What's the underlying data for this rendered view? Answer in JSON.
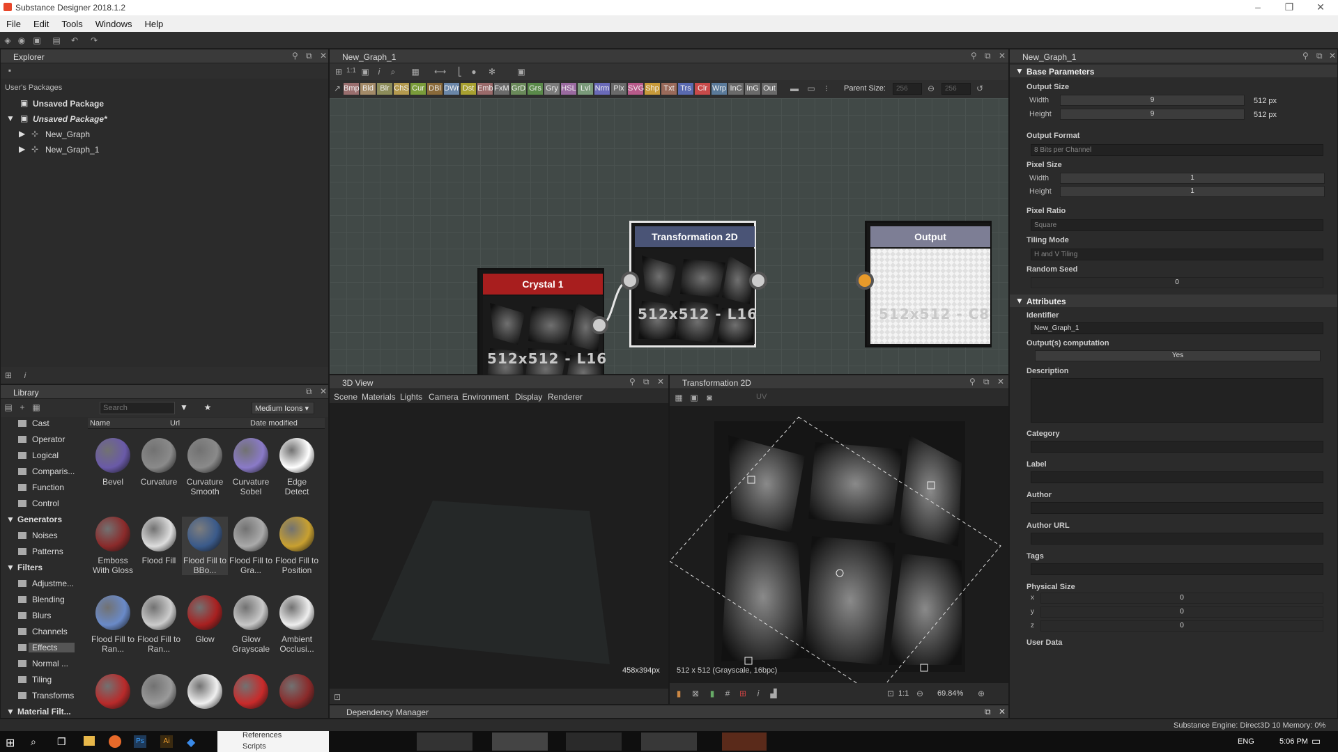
{
  "app": {
    "title": "Substance Designer 2018.1.2"
  },
  "menu": [
    "File",
    "Edit",
    "Tools",
    "Windows",
    "Help"
  ],
  "explorer": {
    "title": "Explorer",
    "section": "User's Packages",
    "packages": [
      "Unsaved Package",
      "Unsaved Package*"
    ],
    "graphs": [
      "New_Graph",
      "New_Graph_1"
    ]
  },
  "graph": {
    "title": "New_Graph_1",
    "toolbar_nodes": [
      "Bmp",
      "Bld",
      "Blr",
      "ChS",
      "Cur",
      "DBl",
      "DWr",
      "Dst",
      "Emb",
      "FxM",
      "GrD",
      "Grs",
      "Gry",
      "HSL",
      "Lvl",
      "Nrm",
      "Plx",
      "SVG",
      "Shp",
      "Txt",
      "Trs",
      "Clr",
      "Wrp",
      "InC",
      "InG",
      "Out"
    ],
    "toolbar_colors": [
      "#9a6e6e",
      "#a38a68",
      "#8c8c5a",
      "#b49a4e",
      "#7a9c3a",
      "#8a6a3a",
      "#6a86a8",
      "#a8a030",
      "#9a6a6a",
      "#6a6a6a",
      "#6a8a5a",
      "#5a8a4a",
      "#7a7a7a",
      "#9a6aa0",
      "#7a9a7a",
      "#6a6ab8",
      "#6a6a6a",
      "#b85a8a",
      "#c89a3a",
      "#9a6a5a",
      "#5a6ab0",
      "#c84a4a",
      "#5a7a9a",
      "#6a6a6a",
      "#6a6a6a",
      "#6a6a6a"
    ],
    "parent_size_label": "Parent Size:",
    "parent_size_w": "256",
    "parent_size_h": "256",
    "nodes": {
      "crystal": {
        "title": "Crystal 1",
        "size": "512x512 - L16",
        "color": "#a81e1e"
      },
      "transform": {
        "title": "Transformation 2D",
        "size": "512x512 - L16",
        "color": "#4a5476"
      },
      "output": {
        "title": "Output",
        "size": "512x512 - C8",
        "color": "#7d7e95"
      }
    }
  },
  "library": {
    "title": "Library",
    "search_placeholder": "Search",
    "view_mode": "Medium Icons",
    "columns": [
      "Name",
      "Url",
      "Date modified"
    ],
    "categories": [
      {
        "label": "Cast",
        "type": "item"
      },
      {
        "label": "Operator",
        "type": "item"
      },
      {
        "label": "Logical",
        "type": "item"
      },
      {
        "label": "Comparis...",
        "type": "item"
      },
      {
        "label": "Function",
        "type": "item"
      },
      {
        "label": "Control",
        "type": "item"
      },
      {
        "label": "Generators",
        "type": "group"
      },
      {
        "label": "Noises",
        "type": "item"
      },
      {
        "label": "Patterns",
        "type": "item"
      },
      {
        "label": "Filters",
        "type": "group"
      },
      {
        "label": "Adjustme...",
        "type": "item"
      },
      {
        "label": "Blending",
        "type": "item"
      },
      {
        "label": "Blurs",
        "type": "item"
      },
      {
        "label": "Channels",
        "type": "item"
      },
      {
        "label": "Effects",
        "type": "item"
      },
      {
        "label": "Normal ...",
        "type": "item"
      },
      {
        "label": "Tiling",
        "type": "item"
      },
      {
        "label": "Transforms",
        "type": "item"
      },
      {
        "label": "Material Filt...",
        "type": "group"
      }
    ],
    "items": [
      {
        "label": "Bevel",
        "color": "#6a5aa8"
      },
      {
        "label": "Curvature",
        "color": "#8a8a8a"
      },
      {
        "label": "Curvature Smooth",
        "color": "#8a8a8a"
      },
      {
        "label": "Curvature Sobel",
        "color": "#8a7ac8"
      },
      {
        "label": "Edge Detect",
        "color": "#ffffff"
      },
      {
        "label": "Emboss With Gloss",
        "color": "#8a2a2a"
      },
      {
        "label": "Flood Fill",
        "color": "#dddddd"
      },
      {
        "label": "Flood Fill to BBo...",
        "color": "#3a5a8a"
      },
      {
        "label": "Flood Fill to Gra...",
        "color": "#aaaaaa"
      },
      {
        "label": "Flood Fill to Position",
        "color": "#c8a030"
      },
      {
        "label": "Flood Fill to Ran...",
        "color": "#6a8ac8"
      },
      {
        "label": "Flood Fill to Ran...",
        "color": "#cccccc"
      },
      {
        "label": "Glow",
        "color": "#a82020"
      },
      {
        "label": "Glow Grayscale",
        "color": "#c8c8c8"
      },
      {
        "label": "Ambient Occlusi...",
        "color": "#eeeeee"
      },
      {
        "label": "",
        "color": "#b82a2a"
      },
      {
        "label": "",
        "color": "#9a9a9a"
      },
      {
        "label": "",
        "color": "#f0f0f0"
      },
      {
        "label": "",
        "color": "#c82a2a"
      },
      {
        "label": "",
        "color": "#8a2a2a"
      }
    ]
  },
  "view3d": {
    "title": "3D View",
    "menu": [
      "Scene",
      "Materials",
      "Lights",
      "Camera",
      "Environment",
      "Display",
      "Renderer"
    ],
    "resolution": "458x394px"
  },
  "view2d": {
    "title": "Transformation 2D",
    "uv_label": "UV",
    "info": "512 x 512 (Grayscale, 16bpc)",
    "ratio": "1:1",
    "zoom": "69.84%"
  },
  "dependency": {
    "title": "Dependency Manager"
  },
  "properties": {
    "title": "New_Graph_1",
    "base_params": "Base Parameters",
    "output_size": {
      "label": "Output Size",
      "width_label": "Width",
      "height_label": "Height",
      "width": "9",
      "height": "9",
      "width_px": "512 px",
      "height_px": "512 px"
    },
    "output_format": {
      "label": "Output Format",
      "value": "8 Bits per Channel"
    },
    "pixel_size": {
      "label": "Pixel Size",
      "width_label": "Width",
      "height_label": "Height",
      "width": "1",
      "height": "1"
    },
    "pixel_ratio": {
      "label": "Pixel Ratio",
      "value": "Square"
    },
    "tiling_mode": {
      "label": "Tiling Mode",
      "value": "H and V Tiling"
    },
    "random_seed": {
      "label": "Random Seed",
      "value": "0"
    },
    "attributes": "Attributes",
    "identifier": {
      "label": "Identifier",
      "value": "New_Graph_1"
    },
    "outputs_computation": {
      "label": "Output(s) computation",
      "value": "Yes"
    },
    "description": "Description",
    "category": "Category",
    "label": "Label",
    "author": "Author",
    "author_url": "Author URL",
    "tags": "Tags",
    "physical_size": {
      "label": "Physical Size",
      "x_label": "x",
      "y_label": "y",
      "z_label": "z",
      "x": "0",
      "y": "0",
      "z": "0"
    },
    "user_data": "User Data"
  },
  "status": {
    "engine": "Substance Engine: Direct3D 10  Memory: 0%"
  },
  "taskbar": {
    "lang": "ENG",
    "time": "5:06 PM",
    "folders": [
      "References",
      "Scripts"
    ]
  }
}
